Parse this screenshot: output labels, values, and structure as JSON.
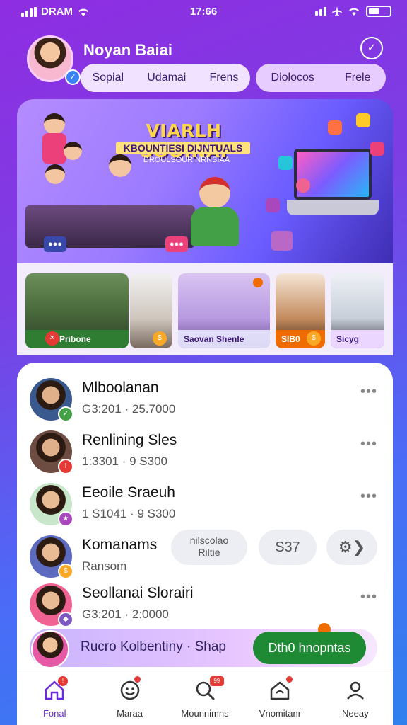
{
  "status_bar": {
    "carrier": "DRAM",
    "time": "17:66"
  },
  "profile": {
    "name": "Noyan Baiai"
  },
  "tabs": [
    "Sopial",
    "Udamai",
    "Frens"
  ],
  "tabs_secondary": [
    "Diolocos",
    "Frele"
  ],
  "banner": {
    "title": "VIARLH SOOINAI",
    "subtitle": "KBOUNTIESI DIJNTUALS",
    "tagline": "DROULSOUR NRNSIAA",
    "colors": {
      "title": "#ffd54a",
      "accent": "#7b5cff"
    }
  },
  "stories": [
    {
      "caption": "Pribone",
      "badge_color": "#e53935"
    },
    {
      "caption": "",
      "badge_color": "#f9a825"
    },
    {
      "caption": "Saovan Shenle",
      "badge_color": "#ef6c00"
    },
    {
      "caption": "SIB0",
      "badge_color": "#f9a825"
    },
    {
      "caption": "Sicyg",
      "badge_color": "#6a2bd9"
    }
  ],
  "list": [
    {
      "name": "Mlboolanan",
      "meta": "G3:201 · 25.7000",
      "badge_color": "#43a047"
    },
    {
      "name": "Renlining Sles",
      "meta": "1:3301 · 9 S300",
      "badge_color": "#e53935"
    },
    {
      "name": "Eeoile Sraeuh",
      "meta": "1 S1041 · 9 S300",
      "badge_color": "#ab47bc"
    },
    {
      "name": "Komanams",
      "meta": "Ransom",
      "badge_color": "#f9a825"
    },
    {
      "name": "Seollanai Slorairi",
      "meta": "G3:201 · 2:0000",
      "badge_color": "#7e57c2"
    }
  ],
  "komanams_actions": {
    "pill1_line1": "nilscolao",
    "pill1_line2": "Riltie",
    "pill2": "S37"
  },
  "cta": {
    "label": "Rucro Kolbentiny · Shap",
    "button": "Dth0 hnopntas"
  },
  "more_label": "•••",
  "bottom_nav": [
    {
      "label": "Fonal",
      "icon": "home-icon",
      "active": true
    },
    {
      "label": "Maraa",
      "icon": "smile-icon",
      "active": false
    },
    {
      "label": "Mounnimns",
      "icon": "search-icon",
      "active": false
    },
    {
      "label": "Vnomitanr",
      "icon": "house-icon",
      "active": false
    },
    {
      "label": "Neeay",
      "icon": "person-icon",
      "active": false
    }
  ]
}
